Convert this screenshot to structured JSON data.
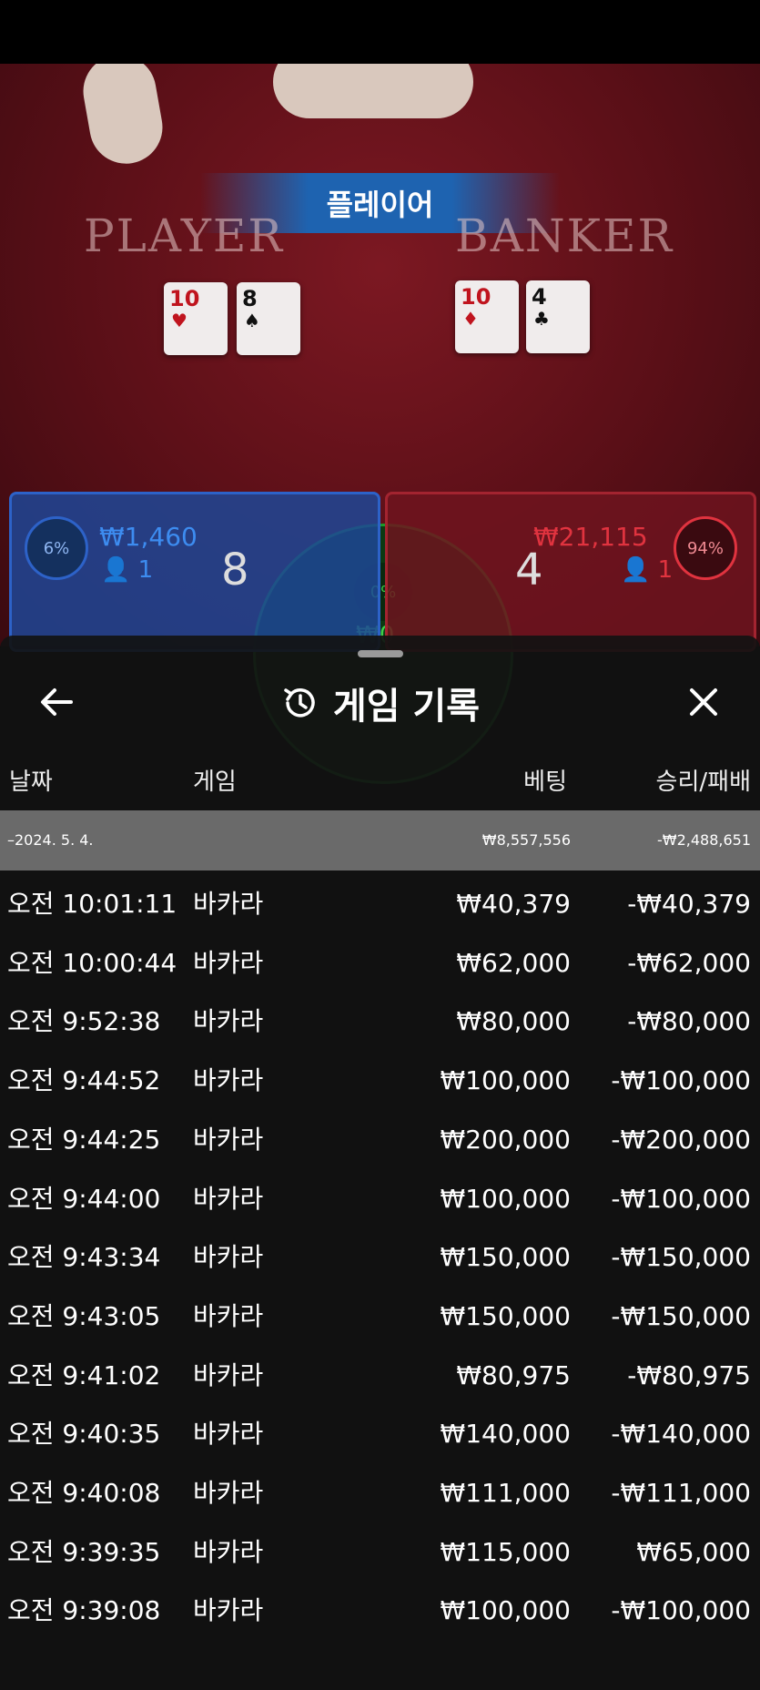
{
  "game_scene": {
    "player_banner": "플레이어",
    "player_label": "PLAYER",
    "banker_label": "BANKER",
    "player_cards": [
      {
        "rank": "10",
        "suit": "♥",
        "color": "red"
      },
      {
        "rank": "8",
        "suit": "♠",
        "color": "black"
      }
    ],
    "banker_cards": [
      {
        "rank": "10",
        "suit": "♦",
        "color": "red"
      },
      {
        "rank": "4",
        "suit": "♣",
        "color": "black"
      }
    ]
  },
  "bet_areas": {
    "player": {
      "percent": "6%",
      "amount": "₩1,460",
      "count": "1",
      "score": "8"
    },
    "banker": {
      "percent": "94%",
      "amount": "₩21,115",
      "count": "1",
      "score": "4"
    },
    "tie": {
      "percent": "0%",
      "amount": "₩0"
    }
  },
  "history_sheet": {
    "title": "게임 기록",
    "columns": {
      "date": "날짜",
      "game": "게임",
      "bet": "베팅",
      "result": "승리/패배"
    },
    "summary": {
      "date": "–2024. 5. 4.",
      "bet": "₩8,557,556",
      "result": "-₩2,488,651"
    },
    "rows": [
      {
        "time": "오전 10:01:11",
        "game": "바카라",
        "bet": "₩40,379",
        "result": "-₩40,379"
      },
      {
        "time": "오전 10:00:44",
        "game": "바카라",
        "bet": "₩62,000",
        "result": "-₩62,000"
      },
      {
        "time": "오전 9:52:38",
        "game": "바카라",
        "bet": "₩80,000",
        "result": "-₩80,000"
      },
      {
        "time": "오전 9:44:52",
        "game": "바카라",
        "bet": "₩100,000",
        "result": "-₩100,000"
      },
      {
        "time": "오전 9:44:25",
        "game": "바카라",
        "bet": "₩200,000",
        "result": "-₩200,000"
      },
      {
        "time": "오전 9:44:00",
        "game": "바카라",
        "bet": "₩100,000",
        "result": "-₩100,000"
      },
      {
        "time": "오전 9:43:34",
        "game": "바카라",
        "bet": "₩150,000",
        "result": "-₩150,000"
      },
      {
        "time": "오전 9:43:05",
        "game": "바카라",
        "bet": "₩150,000",
        "result": "-₩150,000"
      },
      {
        "time": "오전 9:41:02",
        "game": "바카라",
        "bet": "₩80,975",
        "result": "-₩80,975"
      },
      {
        "time": "오전 9:40:35",
        "game": "바카라",
        "bet": "₩140,000",
        "result": "-₩140,000"
      },
      {
        "time": "오전 9:40:08",
        "game": "바카라",
        "bet": "₩111,000",
        "result": "-₩111,000"
      },
      {
        "time": "오전 9:39:35",
        "game": "바카라",
        "bet": "₩115,000",
        "result": "₩65,000"
      },
      {
        "time": "오전 9:39:08",
        "game": "바카라",
        "bet": "₩100,000",
        "result": "-₩100,000"
      }
    ]
  },
  "colors": {
    "player_blue": "#2d62c8",
    "banker_red": "#c0141e",
    "tie_green": "#1c9a2a",
    "summary_bg": "#6a6a6a"
  }
}
